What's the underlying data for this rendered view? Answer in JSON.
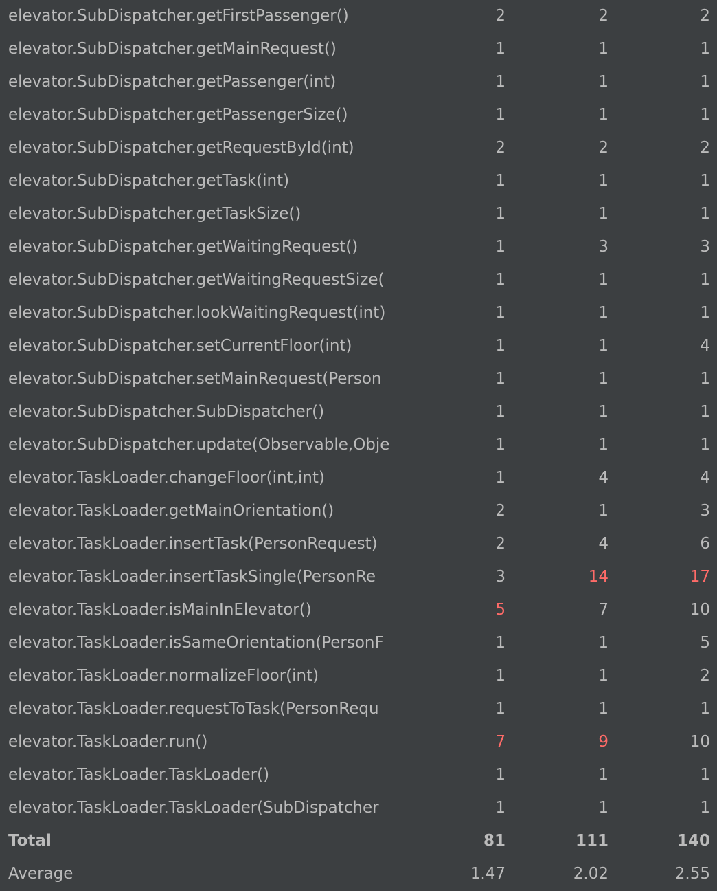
{
  "colors": {
    "background": "#3c3f41",
    "grid": "#2b2b2b",
    "text": "#bbbbbb",
    "highlight": "#ff6b68"
  },
  "rows": [
    {
      "method": "elevator.SubDispatcher.getFirstPassenger()",
      "v1": "2",
      "v2": "2",
      "v3": "2"
    },
    {
      "method": "elevator.SubDispatcher.getMainRequest()",
      "v1": "1",
      "v2": "1",
      "v3": "1"
    },
    {
      "method": "elevator.SubDispatcher.getPassenger(int)",
      "v1": "1",
      "v2": "1",
      "v3": "1"
    },
    {
      "method": "elevator.SubDispatcher.getPassengerSize()",
      "v1": "1",
      "v2": "1",
      "v3": "1"
    },
    {
      "method": "elevator.SubDispatcher.getRequestById(int)",
      "v1": "2",
      "v2": "2",
      "v3": "2"
    },
    {
      "method": "elevator.SubDispatcher.getTask(int)",
      "v1": "1",
      "v2": "1",
      "v3": "1"
    },
    {
      "method": "elevator.SubDispatcher.getTaskSize()",
      "v1": "1",
      "v2": "1",
      "v3": "1"
    },
    {
      "method": "elevator.SubDispatcher.getWaitingRequest()",
      "v1": "1",
      "v2": "3",
      "v3": "3"
    },
    {
      "method": "elevator.SubDispatcher.getWaitingRequestSize(",
      "v1": "1",
      "v2": "1",
      "v3": "1"
    },
    {
      "method": "elevator.SubDispatcher.lookWaitingRequest(int)",
      "v1": "1",
      "v2": "1",
      "v3": "1"
    },
    {
      "method": "elevator.SubDispatcher.setCurrentFloor(int)",
      "v1": "1",
      "v2": "1",
      "v3": "4"
    },
    {
      "method": "elevator.SubDispatcher.setMainRequest(Person",
      "v1": "1",
      "v2": "1",
      "v3": "1"
    },
    {
      "method": "elevator.SubDispatcher.SubDispatcher()",
      "v1": "1",
      "v2": "1",
      "v3": "1"
    },
    {
      "method": "elevator.SubDispatcher.update(Observable,Obje",
      "v1": "1",
      "v2": "1",
      "v3": "1"
    },
    {
      "method": "elevator.TaskLoader.changeFloor(int,int)",
      "v1": "1",
      "v2": "4",
      "v3": "4"
    },
    {
      "method": "elevator.TaskLoader.getMainOrientation()",
      "v1": "2",
      "v2": "1",
      "v3": "3"
    },
    {
      "method": "elevator.TaskLoader.insertTask(PersonRequest)",
      "v1": "2",
      "v2": "4",
      "v3": "6"
    },
    {
      "method": "elevator.TaskLoader.insertTaskSingle(PersonRe",
      "v1": "3",
      "v2": "14",
      "v3": "17",
      "hl2": true,
      "hl3": true
    },
    {
      "method": "elevator.TaskLoader.isMainInElevator()",
      "v1": "5",
      "v2": "7",
      "v3": "10",
      "hl1": true
    },
    {
      "method": "elevator.TaskLoader.isSameOrientation(PersonF",
      "v1": "1",
      "v2": "1",
      "v3": "5"
    },
    {
      "method": "elevator.TaskLoader.normalizeFloor(int)",
      "v1": "1",
      "v2": "1",
      "v3": "2"
    },
    {
      "method": "elevator.TaskLoader.requestToTask(PersonRequ",
      "v1": "1",
      "v2": "1",
      "v3": "1"
    },
    {
      "method": "elevator.TaskLoader.run()",
      "v1": "7",
      "v2": "9",
      "v3": "10",
      "hl1": true,
      "hl2": true
    },
    {
      "method": "elevator.TaskLoader.TaskLoader()",
      "v1": "1",
      "v2": "1",
      "v3": "1"
    },
    {
      "method": "elevator.TaskLoader.TaskLoader(SubDispatcher",
      "v1": "1",
      "v2": "1",
      "v3": "1"
    }
  ],
  "total": {
    "label": "Total",
    "v1": "81",
    "v2": "111",
    "v3": "140"
  },
  "average": {
    "label": "Average",
    "v1": "1.47",
    "v2": "2.02",
    "v3": "2.55"
  }
}
